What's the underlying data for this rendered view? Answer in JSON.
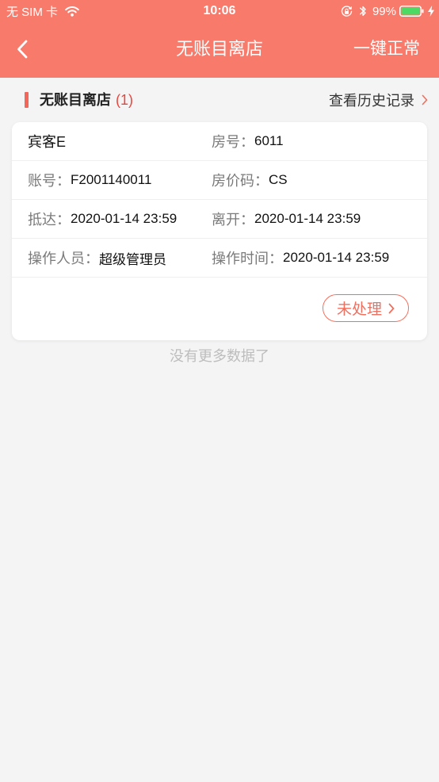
{
  "status_bar": {
    "carrier": "无 SIM 卡",
    "time": "10:06",
    "battery_text": "99%",
    "battery_level": 0.99,
    "icons": {
      "wifi": "wifi-icon",
      "orientation_lock": "orientation-lock-icon",
      "bluetooth": "bluetooth-icon",
      "battery": "battery-icon",
      "charging": "charging-bolt-icon"
    }
  },
  "nav": {
    "back_icon": "chevron-left-icon",
    "title": "无账目离店",
    "action": "一键正常"
  },
  "section": {
    "title": "无账目离店",
    "count": "(1)",
    "history_link": "查看历史记录",
    "history_icon": "chevron-right-icon"
  },
  "records": [
    {
      "guest": "宾客E",
      "room_label": "房号：",
      "room": "6011",
      "account_label": "账号：",
      "account": "F2001140011",
      "rate_code_label": "房价码：",
      "rate_code": "CS",
      "arrival_label": "抵达：",
      "arrival": "2020-01-14 23:59",
      "departure_label": "离开：",
      "departure": "2020-01-14 23:59",
      "operator_label": "操作人员：",
      "operator": "超级管理员",
      "operation_time_label": "操作时间：",
      "operation_time": "2020-01-14 23:59",
      "status_button": "未处理",
      "status_button_icon": "chevron-right-icon"
    }
  ],
  "footer": {
    "no_more": "没有更多数据了"
  },
  "colors": {
    "header_bg": "#F87A6B",
    "accent": "#F0705F",
    "section_bar": "#F2675A",
    "count_red": "#E8463C",
    "page_bg": "#F4F4F5",
    "battery_green": "#4CD964",
    "label_gray": "#7A7A7A",
    "footer_gray": "#BDBDBD"
  }
}
